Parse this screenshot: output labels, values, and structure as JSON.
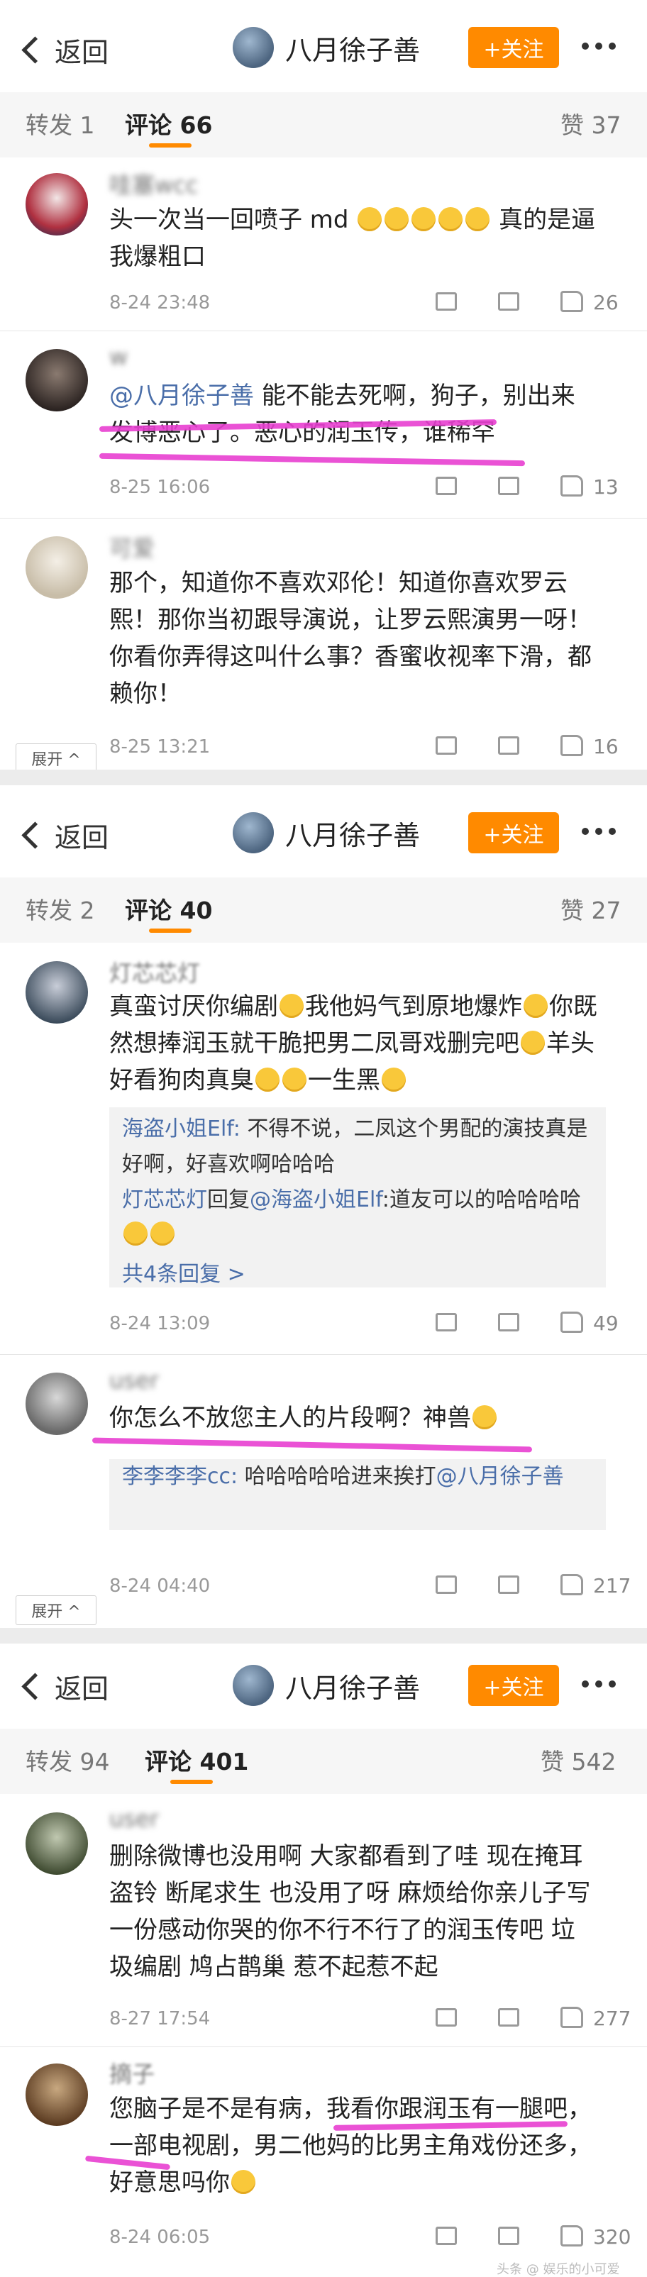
{
  "panels": [
    {
      "header": {
        "back": "返回",
        "user": "八月徐子善",
        "follow": "+关注"
      },
      "tabs": {
        "repost": "转发 1",
        "comment": "评论 66",
        "like": "赞 37"
      },
      "expand_label": "展开 ^",
      "comments": [
        {
          "name": "哇塞wcc",
          "text": "头一次当一回喷子 md",
          "text2": " 真的是逼我爆粗口",
          "time": "8-24 23:48",
          "likes": "26"
        },
        {
          "name": "w",
          "mention": "@八月徐子善",
          "text": " 能不能去死啊，狗子，别出来发博恶心了。恶心的润玉传，谁稀罕",
          "time": "8-25 16:06",
          "likes": "13"
        },
        {
          "name": "可爱",
          "text": "那个，知道你不喜欢邓伦！知道你喜欢罗云熙！那你当初跟导演说，让罗云熙演男一呀！你看你弄得这叫什么事？香蜜收视率下滑，都赖你！",
          "time": "8-25 13:21",
          "likes": "16"
        }
      ]
    },
    {
      "header": {
        "back": "返回",
        "user": "八月徐子善",
        "follow": "+关注"
      },
      "tabs": {
        "repost": "转发 2",
        "comment": "评论 40",
        "like": "赞 27"
      },
      "expand_label": "展开 ^",
      "comments": [
        {
          "name": "灯芯芯灯",
          "text": "真蛮讨厌你编剧",
          "text2": "我他妈气到原地爆炸",
          "text3": "你既然想捧润玉就干脆把男二凤哥戏删完吧",
          "text4": "羊头好看狗肉真臭",
          "text5": "一生黑",
          "time": "8-24 13:09",
          "likes": "49",
          "replies": [
            {
              "name": "海盗小姐Elf:",
              "text": " 不得不说，二凤这个男配的演技真是好啊，好喜欢啊哈哈哈"
            },
            {
              "name": "灯芯芯灯",
              "mid": "回复",
              "to": "@海盗小姐Elf",
              "text": ":道友可以的哈哈哈哈"
            }
          ],
          "more_replies": "共4条回复 >"
        },
        {
          "name": "user",
          "text": "你怎么不放您主人的片段啊？神兽",
          "time": "8-24 04:40",
          "likes": "217",
          "replies": [
            {
              "name": "李李李李cc:",
              "text": " 哈哈哈哈哈进来挨打",
              "to": "@八月徐子善"
            }
          ]
        }
      ]
    },
    {
      "header": {
        "back": "返回",
        "user": "八月徐子善",
        "follow": "+关注"
      },
      "tabs": {
        "repost": "转发 94",
        "comment": "评论 401",
        "like": "赞 542"
      },
      "comments": [
        {
          "name": "user",
          "text": "删除微博也没用啊 大家都看到了哇 现在掩耳盗铃 断尾求生 也没用了呀 麻烦给你亲儿子写一份感动你哭的你不行不行了的润玉传吧 垃圾编剧 鸠占鹊巢 惹不起惹不起",
          "time": "8-27 17:54",
          "likes": "277"
        },
        {
          "name": "摘子",
          "text": "您脑子是不是有病，我看你跟润玉有一腿吧，一部电视剧，男二他妈的比男主角戏份还多，好意思吗你",
          "time": "8-24 06:05",
          "likes": "320"
        }
      ]
    }
  ],
  "watermark": "头条 @ 娱乐的小可爱",
  "colors": {
    "accent": "#ff8a00",
    "link": "#4a6ea9",
    "highlight": "#e83fd0"
  }
}
